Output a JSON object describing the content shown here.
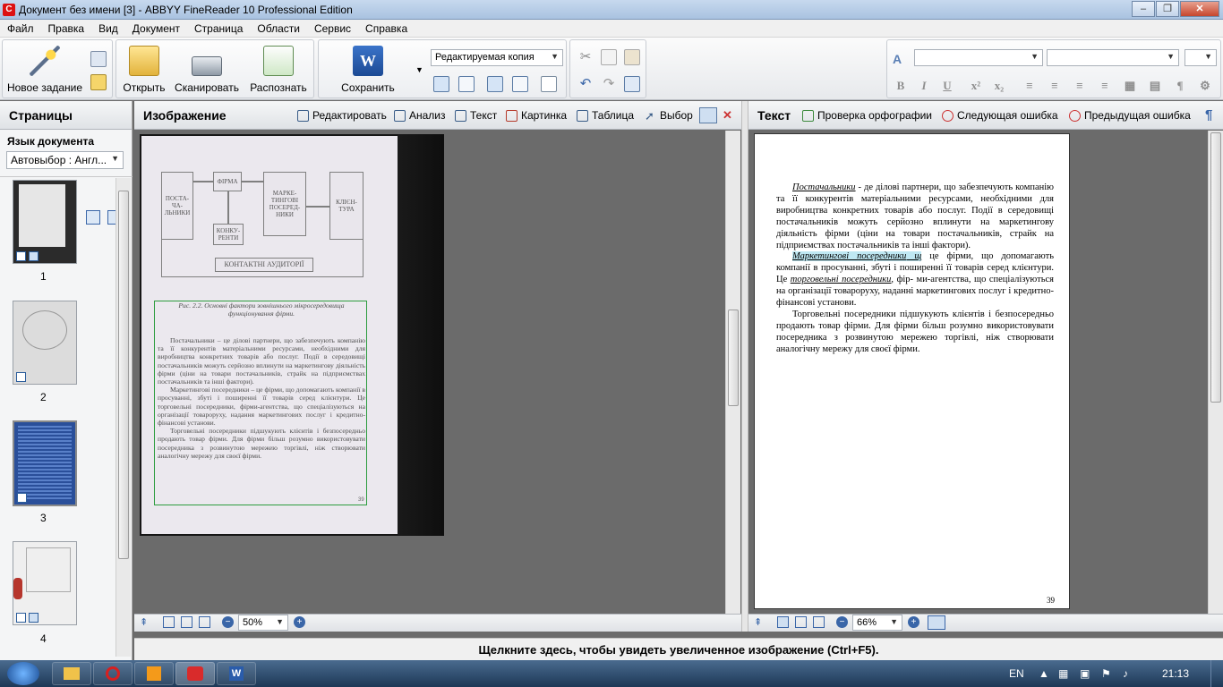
{
  "window": {
    "title": "Документ без имени [3] - ABBYY FineReader 10 Professional Edition",
    "app_icon": "finereader-icon"
  },
  "menu": [
    "Файл",
    "Правка",
    "Вид",
    "Документ",
    "Страница",
    "Области",
    "Сервис",
    "Справка"
  ],
  "toolbar": {
    "new_task": "Новое задание",
    "open": "Открыть",
    "scan": "Сканировать",
    "recognize": "Распознать",
    "save": "Сохранить",
    "save_format": "Редактируемая копия",
    "font_name": "",
    "font_size": ""
  },
  "pages_panel": {
    "title": "Страницы",
    "language_label": "Язык документа",
    "language_value": "Автовыбор : Англ...",
    "thumbnails": [
      "1",
      "2",
      "3",
      "4"
    ]
  },
  "image_panel": {
    "title": "Изображение",
    "tools": [
      "Редактировать",
      "Анализ",
      "Текст",
      "Картинка",
      "Таблица",
      "Выбор"
    ],
    "zoom": "50%"
  },
  "scan": {
    "boxes": {
      "suppliers": "ПОСТА-ЧА-ЛЬНИКИ",
      "firm": "ФІРМА",
      "intermediaries": "МАРКЕ-ТИНГОВІ ПОСЕРЕД-НИКИ",
      "clients": "КЛІЄН-ТУРА",
      "competitors": "КОНКУ-РЕНТИ",
      "audiences": "КОНТАКТНІ АУДИТОРІЇ"
    },
    "caption": "Рис. 2.2. Основні фактори зовнішнього мікросередовища функціонування фірми.",
    "p1": "Постачальники – це ділові партнери, що забезпечують компанію та її конкурентів матеріальними ресурсами, необхідними для виробництва конкретних товарів або послуг. Події в середовищі постачальників можуть серйозно вплинути на маркетингову діяльність фірми (ціни на товари постачальників, страйк на підприємствах постачальників та інші фактори).",
    "p2": "Маркетингові посередники – це фірми, що допомагають компанії в просуванні, збуті і поширенні її товарів серед клієнтури. Це торговельні посередники, фірми-агентства, що спеціалізуються на організації товароруху, надання маркетингових послуг і кредитно-фінансові установи.",
    "p3": "Торговельні посередники підшукують клієнтів і безпосередньо продають товар фірми. Для фірми більш розумно використовувати посередника з розвинутою мережею торгівлі, ніж створювати аналогічну мережу для своєї фірми.",
    "page_number": "39"
  },
  "text_panel": {
    "title": "Текст",
    "spellcheck": "Проверка орфографии",
    "next_error": "Следующая ошибка",
    "prev_error": "Предыдущая ошибка",
    "zoom": "66%",
    "page_number": "39",
    "p1_term": "Постачальники",
    "p1_rest": " - де ділові партнери, що забезпечують компанію та її конкурентів матеріальними ресурсами, необхідними для виробництва конкретних товарів або послуг. Події в середовищі постачальників можуть серйозно вплинути на маркетингову діяльність фірми (ціни на товари постачальників, страйк на підприємствах постачальників та інші фактори).",
    "p2_term": "Маркетингові посередники",
    "p2_mid": " щ",
    "p2_rest1": " це фірми, що допомагають компанії в просуванні, збуті і поширенні її товарів серед клієнтури. Це ",
    "p2_term2": "торговельні посередники",
    "p2_rest2": ", фір- ми-агентства, що спеціалізуються на організації товароруху, наданні маркетингових послуг і кредитно- фінансові установи.",
    "p3": "Торговельні посередники підшукують клієнтів і безпосередньо продають товар фірми. Для фірми більш розумно використовувати посередника з розвинутою мережею торгівлі, ніж створювати аналогічну мережу для своєї фірми."
  },
  "status": "Щелкните здесь, чтобы увидеть увеличенное изображение (Ctrl+F5).",
  "taskbar": {
    "lang": "EN",
    "time": "21:13"
  }
}
